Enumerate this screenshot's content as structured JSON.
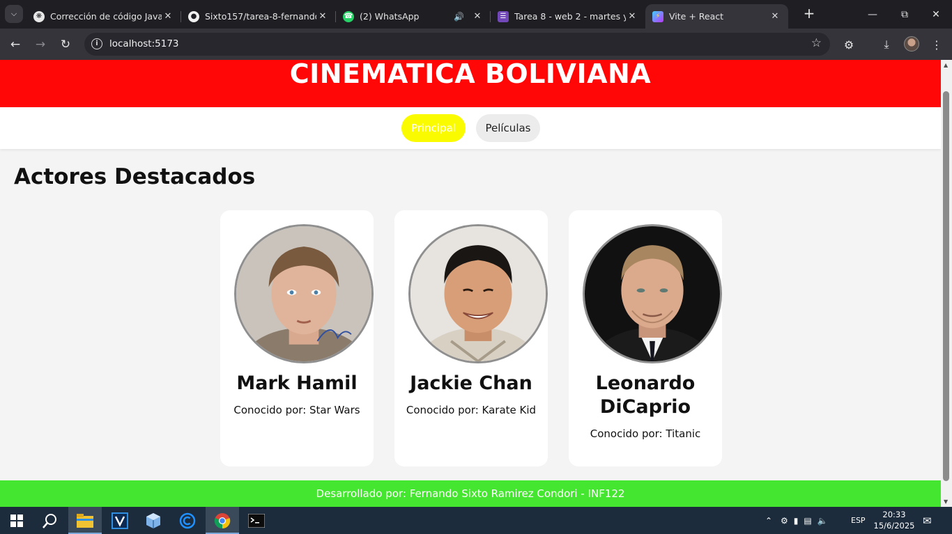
{
  "browser": {
    "tabs": [
      {
        "title": "Corrección de código Java",
        "icon": "chatgpt-icon"
      },
      {
        "title": "Sixto157/tarea-8-fernando-s",
        "icon": "github-icon"
      },
      {
        "title": "(2) WhatsApp",
        "icon": "whatsapp-icon"
      },
      {
        "title": "Tarea 8 - web 2 - martes y ju",
        "icon": "forms-icon"
      },
      {
        "title": "Vite + React",
        "icon": "vite-icon",
        "active": true
      }
    ],
    "url": "localhost:5173"
  },
  "site": {
    "title": "CINEMATICA BOLIVIANA",
    "nav": {
      "principal": "Principal",
      "peliculas": "Películas"
    },
    "section_title": "Actores Destacados",
    "actors": [
      {
        "name": "Mark Hamil",
        "known_for": "Conocido por: Star Wars"
      },
      {
        "name": "Jackie Chan",
        "known_for": "Conocido por: Karate Kid"
      },
      {
        "name": "Leonardo DiCaprio",
        "known_for": "Conocido por: Titanic"
      }
    ],
    "footer": "Desarrollado por: Fernando Sixto Ramirez Condori - INF122",
    "colors": {
      "header": "#ff0707",
      "nav_active": "#fbfb00",
      "footer": "#45e62f"
    }
  },
  "taskbar": {
    "language": "ESP",
    "time": "20:33",
    "date": "15/6/2025"
  }
}
